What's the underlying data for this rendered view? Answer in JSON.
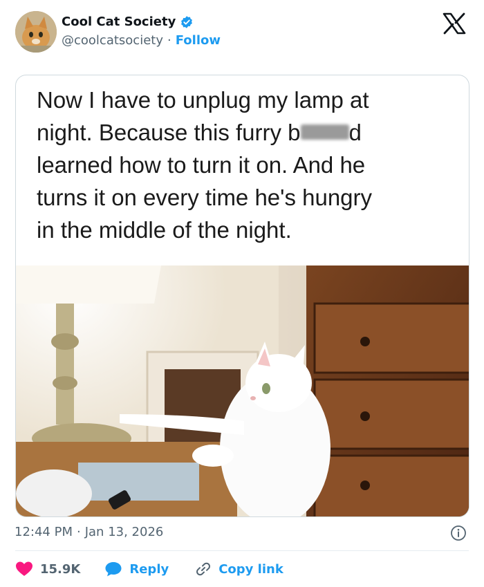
{
  "author": {
    "name": "Cool Cat Society",
    "handle": "@coolcatsociety",
    "separator": "·",
    "follow_label": "Follow"
  },
  "icons": {
    "avatar": "cat-avatar",
    "verified": "verified-badge-icon",
    "brand": "x-logo-icon",
    "info": "info-icon",
    "like": "heart-icon",
    "reply": "speech-bubble-icon",
    "copy": "link-icon"
  },
  "colors": {
    "accent": "#1d9bf0",
    "like": "#f91880",
    "muted": "#536471"
  },
  "post": {
    "caption_line1": "Now I have to unplug my lamp at",
    "caption_line2_a": "night. Because this furry b",
    "caption_line2_b": "d",
    "caption_line3": "learned how to turn it on. And he",
    "caption_line4": "turns it on every time he's hungry",
    "caption_line5": "in the middle of the night.",
    "time": "12:44 PM",
    "date_separator": "·",
    "date": "Jan 13, 2026"
  },
  "actions": {
    "likes_count": "15.9K",
    "reply_label": "Reply",
    "copy_label": "Copy link"
  }
}
